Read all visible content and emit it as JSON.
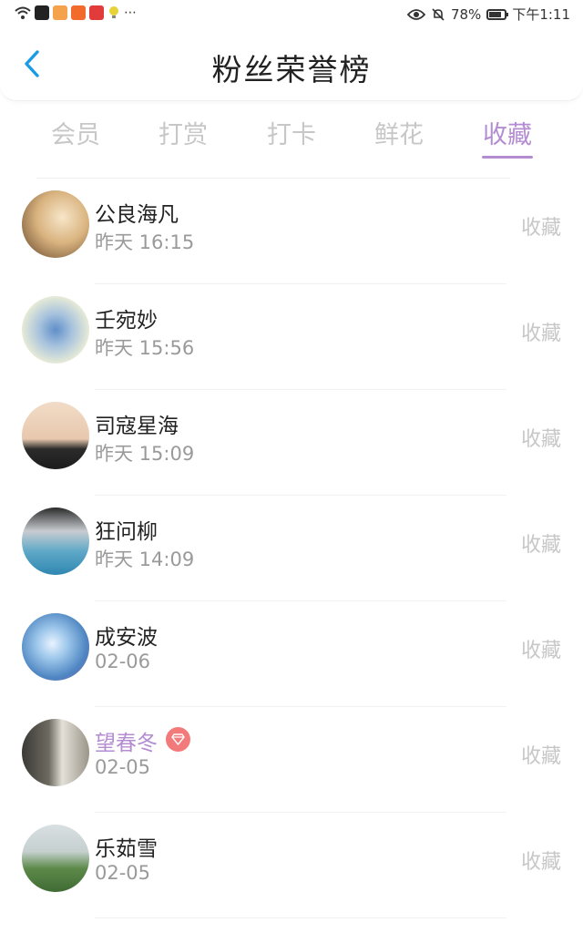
{
  "status_bar": {
    "battery_pct": "78%",
    "time": "下午1:11",
    "battery_level": 0.78,
    "notif_icons": [
      "wifi-icon",
      "app-icon-1",
      "app-icon-2",
      "app-icon-3",
      "app-icon-4",
      "lightbulb-icon",
      "more-dots-icon"
    ]
  },
  "header": {
    "title": "粉丝荣誉榜",
    "back_icon": "chevron-left-icon",
    "accent_color": "#1a9be6"
  },
  "tabs": [
    {
      "label": "会员"
    },
    {
      "label": "打赏"
    },
    {
      "label": "打卡"
    },
    {
      "label": "鲜花"
    },
    {
      "label": "收藏"
    }
  ],
  "active_tab": "收藏",
  "theme": {
    "active_color": "#b48cd2",
    "muted_color": "#c7c7c7",
    "badge_color": "#f37a7a"
  },
  "fans": [
    {
      "name": "公良海凡",
      "time": "昨天 16:15",
      "action": "收藏",
      "vip": false
    },
    {
      "name": "壬宛妙",
      "time": "昨天 15:56",
      "action": "收藏",
      "vip": false
    },
    {
      "name": "司寇星海",
      "time": "昨天 15:09",
      "action": "收藏",
      "vip": false
    },
    {
      "name": "狂问柳",
      "time": "昨天 14:09",
      "action": "收藏",
      "vip": false
    },
    {
      "name": "成安波",
      "time": "02-06",
      "action": "收藏",
      "vip": false
    },
    {
      "name": "望春冬",
      "time": "02-05",
      "action": "收藏",
      "vip": true
    },
    {
      "name": "乐茹雪",
      "time": "02-05",
      "action": "收藏",
      "vip": false
    }
  ]
}
